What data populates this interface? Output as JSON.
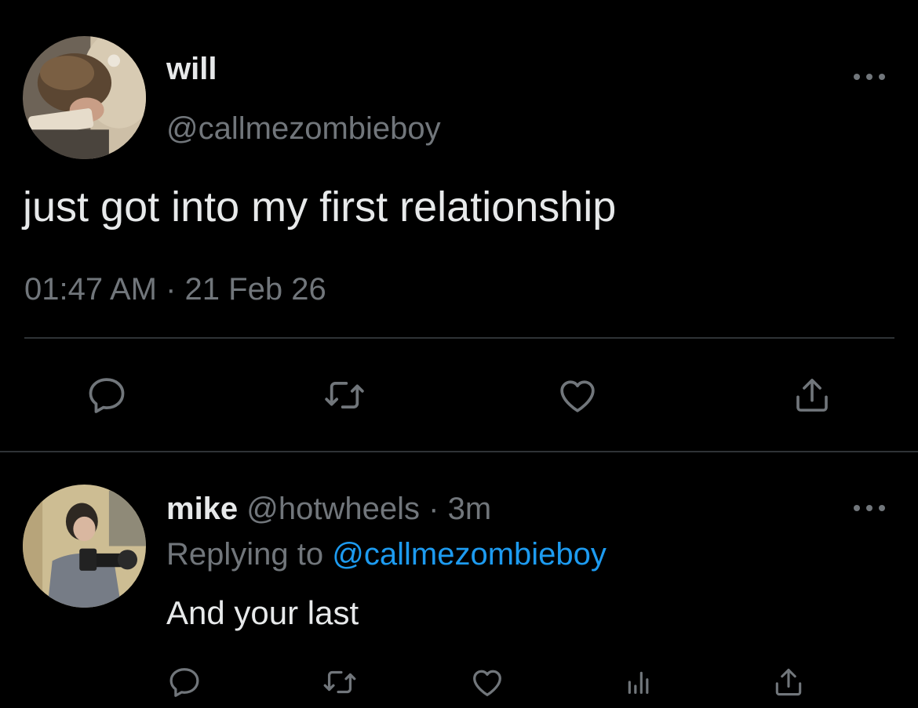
{
  "tweet": {
    "author_name": "will",
    "author_handle": "@callmezombieboy",
    "text": "just got into my first relationship",
    "timestamp": "01:47 AM · 21 Feb 26",
    "actions": [
      "reply-icon",
      "retweet-icon",
      "like-icon",
      "share-icon"
    ]
  },
  "reply": {
    "author_name": "mike",
    "author_handle": "@hotwheels",
    "separator": "·",
    "time_ago": "3m",
    "replying_to_label": "Replying to",
    "replying_to_handle": "@callmezombieboy",
    "text": "And your last",
    "actions": [
      "reply-icon",
      "retweet-icon",
      "like-icon",
      "analytics-icon",
      "share-icon"
    ]
  },
  "colors": {
    "background": "#000000",
    "primary_text": "#e7e9ea",
    "secondary_text": "#71767b",
    "link": "#1d9bf0",
    "divider": "#2f3336"
  }
}
